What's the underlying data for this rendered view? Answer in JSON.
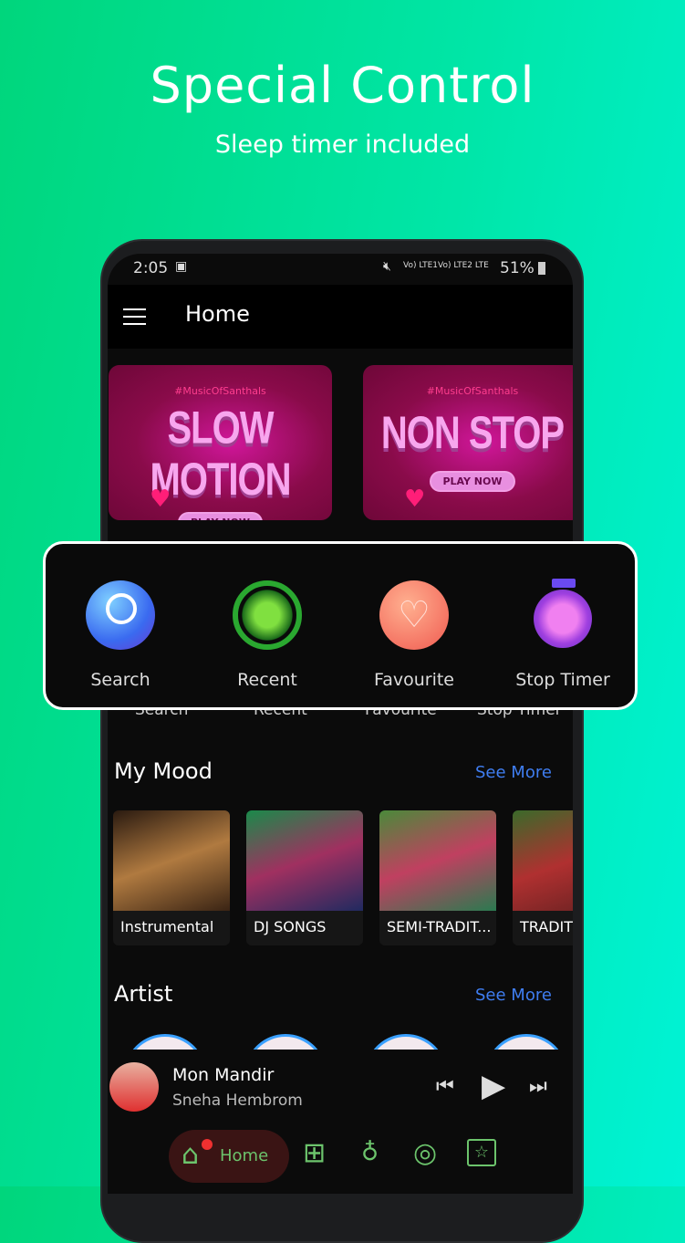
{
  "promo": {
    "title": "Special Control",
    "subtitle": "Sleep timer included"
  },
  "status_bar": {
    "time": "2:05",
    "signal_text_1": "Vo) LTE1",
    "signal_text_2": "Vo) LTE2 LTE",
    "battery": "51%"
  },
  "app_bar": {
    "title": "Home"
  },
  "banners": [
    {
      "tag": "#MusicOfSanthals",
      "title": "SLOW MOTION",
      "button": "PLAY NOW"
    },
    {
      "tag": "#MusicOfSanthals",
      "title": "NON STOP",
      "button": "PLAY NOW"
    }
  ],
  "quick_actions": [
    {
      "label": "Search",
      "icon": "search-icon"
    },
    {
      "label": "Recent",
      "icon": "recent-icon"
    },
    {
      "label": "Favourite",
      "icon": "heart-icon"
    },
    {
      "label": "Stop Timer",
      "icon": "timer-icon"
    }
  ],
  "my_mood": {
    "title": "My Mood",
    "see_more": "See More",
    "items": [
      {
        "label": "Instrumental"
      },
      {
        "label": "DJ SONGS"
      },
      {
        "label": "SEMI-TRADIT..."
      },
      {
        "label": "TRADITI"
      }
    ]
  },
  "artist": {
    "title": "Artist",
    "see_more": "See More"
  },
  "now_playing": {
    "song": "Mon Mandir",
    "artist": "Sneha Hembrom"
  },
  "bottom_nav": {
    "active": "Home",
    "accent": "#6cc46c"
  },
  "colors": {
    "background_left": "#00d67c",
    "background_right": "#00f3d6",
    "link": "#3f7df0"
  }
}
